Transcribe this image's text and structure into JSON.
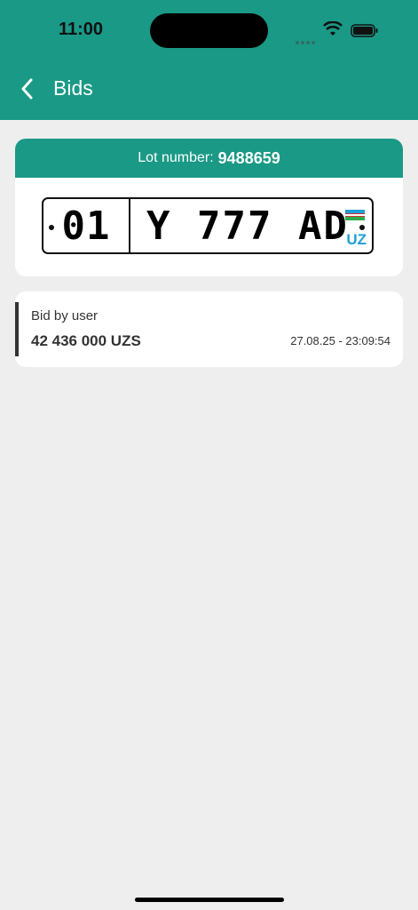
{
  "status_bar": {
    "time": "11:00"
  },
  "header": {
    "title": "Bids",
    "back_icon": "chevron-left-icon"
  },
  "lot": {
    "label": "Lot number:",
    "number": "9488659",
    "plate": {
      "region": "01",
      "number": "Y 777 AD",
      "country": "UZ",
      "flag_colors": [
        "#1e9fd8",
        "#ffffff",
        "#2dad4a"
      ]
    }
  },
  "bid": {
    "label": "Bid by user",
    "amount": "42 436 000 UZS",
    "timestamp": "27.08.25 - 23:09:54"
  },
  "colors": {
    "primary": "#1a9986",
    "background": "#eeeeee"
  }
}
